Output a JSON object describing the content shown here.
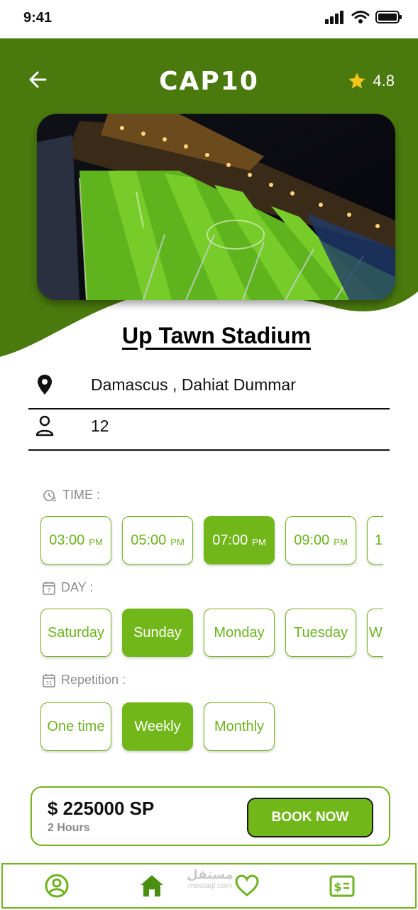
{
  "status_bar": {
    "time": "9:41"
  },
  "header": {
    "logo_text": "CAP10",
    "rating": "4.8"
  },
  "stadium": {
    "name": "Up Tawn Stadium",
    "location": "Damascus , Dahiat Dummar",
    "capacity": "12"
  },
  "time_section": {
    "label": "TIME :",
    "options": [
      {
        "time": "03:00",
        "period": "PM",
        "selected": false
      },
      {
        "time": "05:00",
        "period": "PM",
        "selected": false
      },
      {
        "time": "07:00",
        "period": "PM",
        "selected": true
      },
      {
        "time": "09:00",
        "period": "PM",
        "selected": false
      },
      {
        "time": "1",
        "period": "",
        "selected": false
      }
    ]
  },
  "day_section": {
    "label": "DAY :",
    "options": [
      {
        "label": "Saturday",
        "selected": false
      },
      {
        "label": "Sunday",
        "selected": true
      },
      {
        "label": "Monday",
        "selected": false
      },
      {
        "label": "Tuesday",
        "selected": false
      },
      {
        "label": "W",
        "selected": false
      }
    ]
  },
  "repetition_section": {
    "label": "Repetition :",
    "options": [
      {
        "label": "One time",
        "selected": false
      },
      {
        "label": "Weekly",
        "selected": true
      },
      {
        "label": "Monthly",
        "selected": false
      }
    ]
  },
  "booking": {
    "price": "$ 225000 SP",
    "duration": "2 Hours",
    "button_label": "BOOK NOW"
  },
  "tab_bar": {
    "items": [
      "profile-icon",
      "home-icon",
      "favorites-icon",
      "payments-icon"
    ],
    "active": "home-icon"
  },
  "watermark": {
    "arabic": "مستقل",
    "latin": "mostaql.com"
  },
  "colors": {
    "primary_green": "#4a7a0e",
    "accent_green": "#72b71a",
    "star": "#f5c518"
  }
}
